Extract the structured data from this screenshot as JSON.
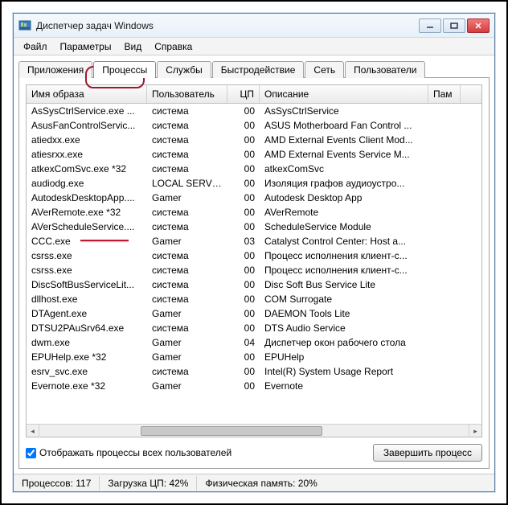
{
  "window": {
    "title": "Диспетчер задач Windows"
  },
  "menu": {
    "file": "Файл",
    "options": "Параметры",
    "view": "Вид",
    "help": "Справка"
  },
  "tabs": {
    "applications": "Приложения",
    "processes": "Процессы",
    "services": "Службы",
    "performance": "Быстродействие",
    "networking": "Сеть",
    "users": "Пользователи"
  },
  "columns": {
    "image_name": "Имя образа",
    "user": "Пользователь",
    "cpu": "ЦП",
    "description": "Описание",
    "memory": "Пам"
  },
  "processes": [
    {
      "name": "AsSysCtrlService.exe ...",
      "user": "система",
      "cpu": "00",
      "desc": "AsSysCtrlService"
    },
    {
      "name": "AsusFanControlServic...",
      "user": "система",
      "cpu": "00",
      "desc": "ASUS Motherboard Fan Control ..."
    },
    {
      "name": "atiedxx.exe",
      "user": "система",
      "cpu": "00",
      "desc": "AMD External Events Client Mod..."
    },
    {
      "name": "atiesrxx.exe",
      "user": "система",
      "cpu": "00",
      "desc": "AMD External Events Service M..."
    },
    {
      "name": "atkexComSvc.exe *32",
      "user": "система",
      "cpu": "00",
      "desc": "atkexComSvc"
    },
    {
      "name": "audiodg.exe",
      "user": "LOCAL SERVICE",
      "cpu": "00",
      "desc": "Изоляция графов аудиоустро..."
    },
    {
      "name": "AutodeskDesktopApp....",
      "user": "Gamer",
      "cpu": "00",
      "desc": "Autodesk Desktop App"
    },
    {
      "name": "AVerRemote.exe *32",
      "user": "система",
      "cpu": "00",
      "desc": "AVerRemote"
    },
    {
      "name": "AVerScheduleService....",
      "user": "система",
      "cpu": "00",
      "desc": "ScheduleService Module"
    },
    {
      "name": "CCC.exe",
      "user": "Gamer",
      "cpu": "03",
      "desc": "Catalyst Control Center: Host a..."
    },
    {
      "name": "csrss.exe",
      "user": "система",
      "cpu": "00",
      "desc": "Процесс исполнения клиент-с..."
    },
    {
      "name": "csrss.exe",
      "user": "система",
      "cpu": "00",
      "desc": "Процесс исполнения клиент-с..."
    },
    {
      "name": "DiscSoftBusServiceLit...",
      "user": "система",
      "cpu": "00",
      "desc": "Disc Soft Bus Service Lite"
    },
    {
      "name": "dllhost.exe",
      "user": "система",
      "cpu": "00",
      "desc": "COM Surrogate"
    },
    {
      "name": "DTAgent.exe",
      "user": "Gamer",
      "cpu": "00",
      "desc": "DAEMON Tools Lite"
    },
    {
      "name": "DTSU2PAuSrv64.exe",
      "user": "система",
      "cpu": "00",
      "desc": "DTS Audio Service"
    },
    {
      "name": "dwm.exe",
      "user": "Gamer",
      "cpu": "04",
      "desc": "Диспетчер окон рабочего стола"
    },
    {
      "name": "EPUHelp.exe *32",
      "user": "Gamer",
      "cpu": "00",
      "desc": "EPUHelp"
    },
    {
      "name": "esrv_svc.exe",
      "user": "система",
      "cpu": "00",
      "desc": "Intel(R) System Usage Report"
    },
    {
      "name": "Evernote.exe *32",
      "user": "Gamer",
      "cpu": "00",
      "desc": "Evernote"
    }
  ],
  "checkbox": {
    "label": "Отображать процессы всех пользователей",
    "checked": true
  },
  "buttons": {
    "end_process": "Завершить процесс"
  },
  "statusbar": {
    "processes_label": "Процессов:",
    "processes_count": "117",
    "cpu_label": "Загрузка ЦП:",
    "cpu_value": "42%",
    "mem_label": "Физическая память:",
    "mem_value": "20%"
  }
}
